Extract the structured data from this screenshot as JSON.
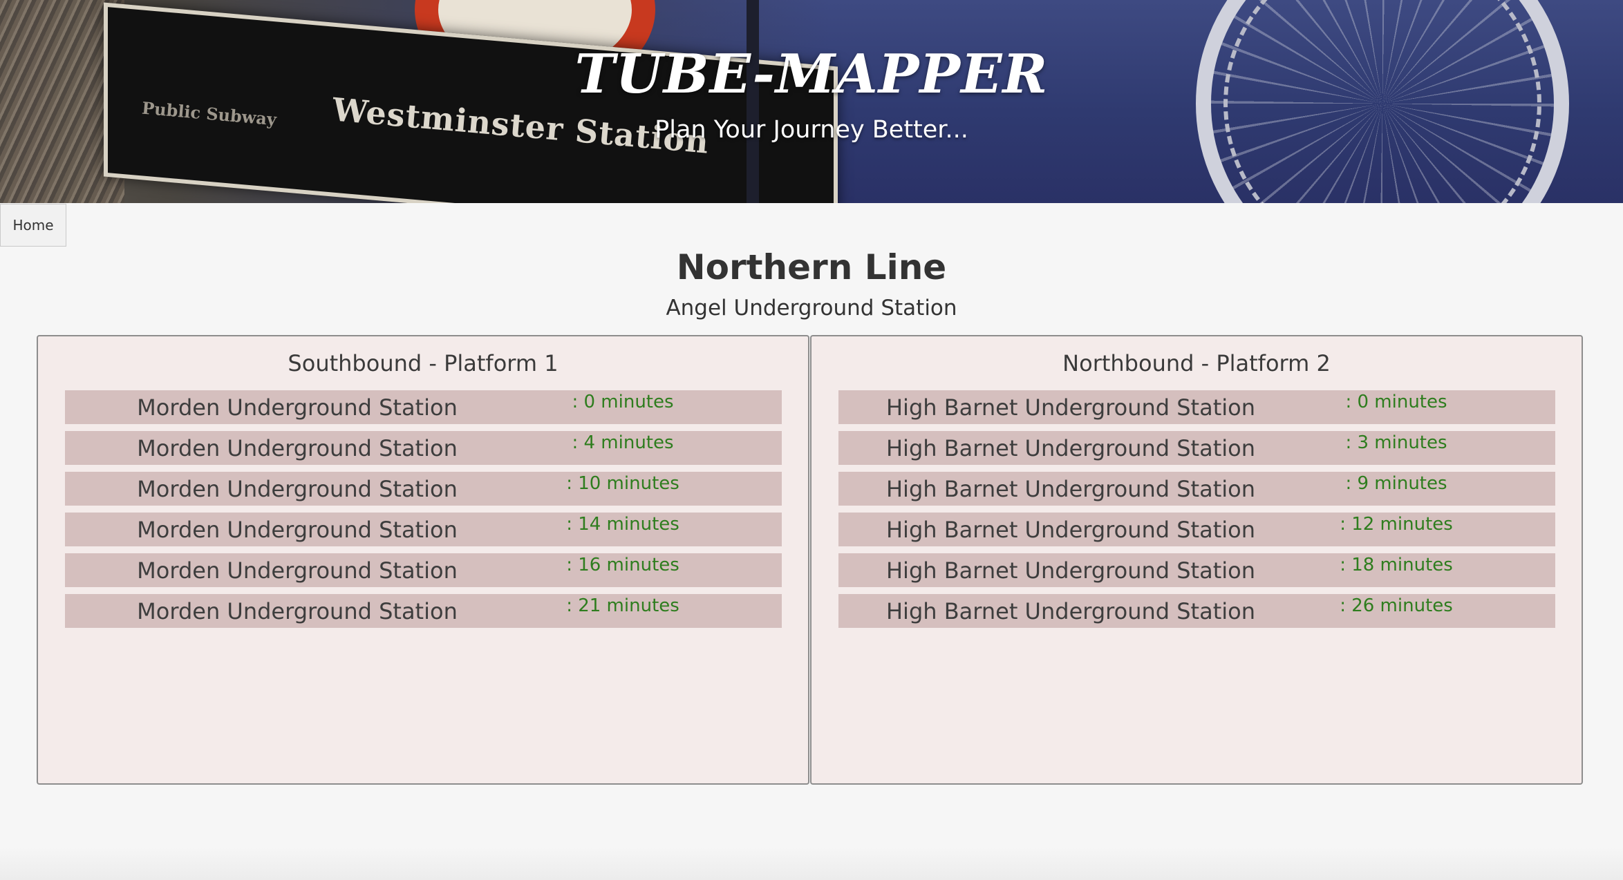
{
  "header": {
    "title": "TUBE-MAPPER",
    "subtitle": "Plan Your Journey Better...",
    "sign_text": "Westminster Station",
    "sign_small": "Public Subway"
  },
  "nav": {
    "home_label": "Home"
  },
  "main": {
    "line_name": "Northern Line",
    "station_name": "Angel Underground Station",
    "platforms": [
      {
        "title": "Southbound - Platform 1",
        "arrivals": [
          {
            "destination": "Morden Underground Station",
            "time": ": 0 minutes"
          },
          {
            "destination": "Morden Underground Station",
            "time": ": 4 minutes"
          },
          {
            "destination": "Morden Underground Station",
            "time": ": 10 minutes"
          },
          {
            "destination": "Morden Underground Station",
            "time": ": 14 minutes"
          },
          {
            "destination": "Morden Underground Station",
            "time": ": 16 minutes"
          },
          {
            "destination": "Morden Underground Station",
            "time": ": 21 minutes"
          }
        ]
      },
      {
        "title": "Northbound - Platform 2",
        "arrivals": [
          {
            "destination": "High Barnet Underground Station",
            "time": ": 0 minutes"
          },
          {
            "destination": "High Barnet Underground Station",
            "time": ": 3 minutes"
          },
          {
            "destination": "High Barnet Underground Station",
            "time": ": 9 minutes"
          },
          {
            "destination": "High Barnet Underground Station",
            "time": ": 12 minutes"
          },
          {
            "destination": "High Barnet Underground Station",
            "time": ": 18 minutes"
          },
          {
            "destination": "High Barnet Underground Station",
            "time": ": 26 minutes"
          }
        ]
      }
    ]
  },
  "colors": {
    "panel_bg": "#f4ebea",
    "row_bg": "#d5bfbe",
    "minutes_text": "#2e7d1e",
    "page_bg": "#f6f6f6"
  }
}
